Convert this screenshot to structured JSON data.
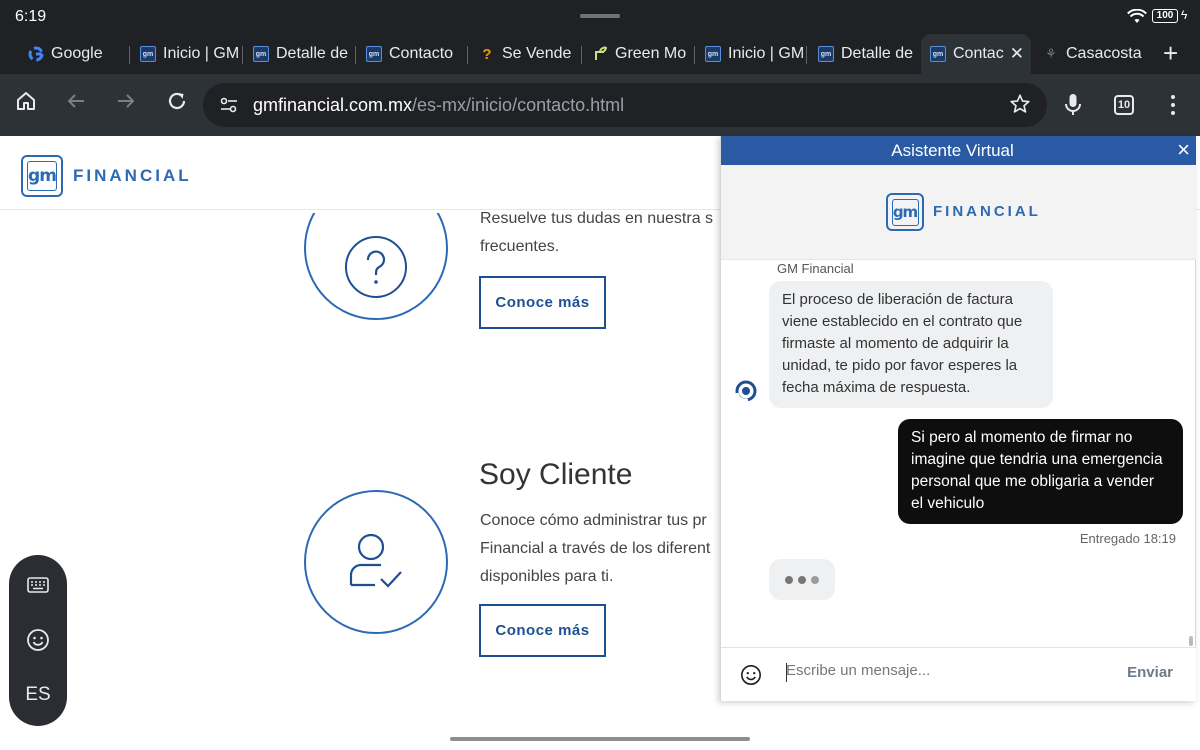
{
  "status": {
    "time": "6:19",
    "battery": "100"
  },
  "tabs": [
    {
      "label": "Google",
      "favicon": "google-icon"
    },
    {
      "label": "Inicio | GM",
      "favicon": "gm-icon"
    },
    {
      "label": "Detalle de",
      "favicon": "gm-icon"
    },
    {
      "label": "Contacto",
      "favicon": "gm-icon"
    },
    {
      "label": "Se Vende",
      "favicon": "location-icon"
    },
    {
      "label": "Green Mo",
      "favicon": "plant-icon"
    },
    {
      "label": "Inicio | GM",
      "favicon": "gm-icon"
    },
    {
      "label": "Detalle de",
      "favicon": "gm-icon"
    },
    {
      "label": "Contac",
      "favicon": "gm-icon",
      "active": true
    },
    {
      "label": "Casacosta",
      "favicon": "site-icon"
    }
  ],
  "toolbar": {
    "url_host": "gmfinancial.com.mx",
    "url_path": "/es-mx/inicio/contacto.html",
    "tab_count": "10"
  },
  "site": {
    "logo_mark": "gm",
    "logo_word": "FINANCIAL",
    "faq_text_line1": "Resuelve tus dudas en nuestra s",
    "faq_text_line2": "frecuentes.",
    "faq_button": "Conoce más",
    "client_heading": "Soy Cliente",
    "client_line1": "Conoce cómo administrar tus pr",
    "client_line2": "Financial a través de los diferent",
    "client_line3": "disponibles para ti.",
    "client_button": "Conoce más"
  },
  "keyboard": {
    "lang": "ES"
  },
  "chat": {
    "title": "Asistente Virtual",
    "brand_mark": "gm",
    "brand_word": "FINANCIAL",
    "sender": "GM Financial",
    "bot_lines": [
      "El proceso de liberación de factura",
      "viene establecido en el contrato que",
      "firmaste al momento de adquirir la",
      "unidad, te pido por favor esperes la",
      "fecha máxima de respuesta."
    ],
    "user_lines": [
      "Si pero al momento de firmar no",
      "imagine que tendria una emergencia",
      "personal que me obligaria a vender",
      "el vehiculo"
    ],
    "delivered": "Entregado 18:19",
    "placeholder": "Escribe un mensaje...",
    "send": "Enviar"
  },
  "colors": {
    "brand_blue": "#2d6ab4",
    "chat_header": "#2a5aa3",
    "user_bubble": "#0e0e0e"
  }
}
